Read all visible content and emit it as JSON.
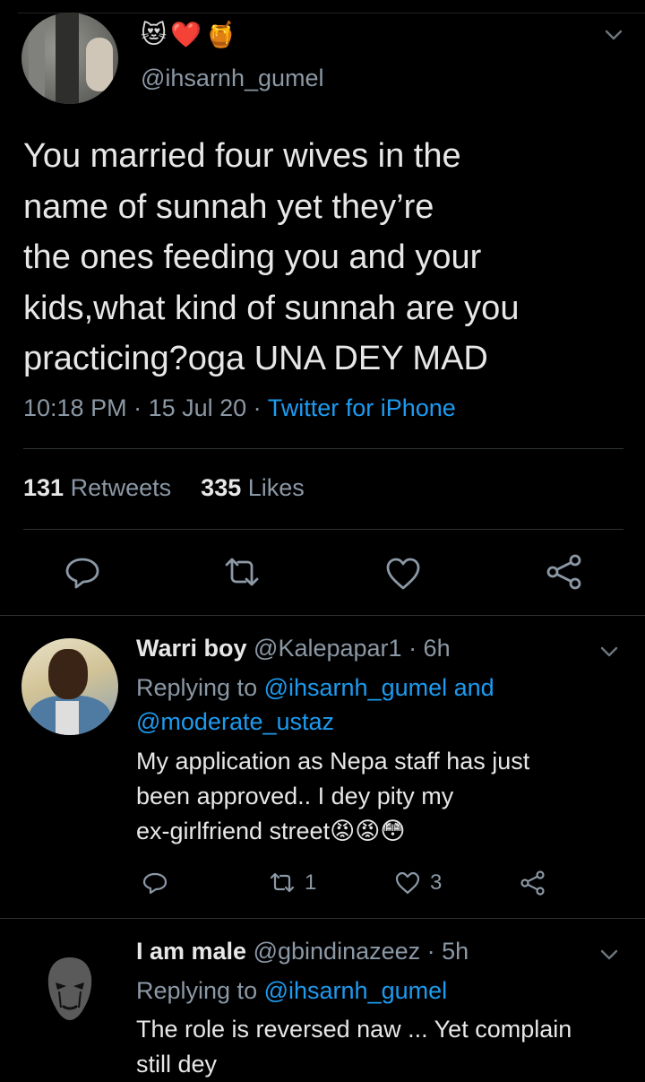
{
  "main_tweet": {
    "emojis": [
      "😻",
      "❤️",
      "🍯"
    ],
    "handle": "@ihsarnh_gumel",
    "text_lines": [
      "You married four wives in the",
      "name of sunnah yet they’re",
      "the ones feeding you and your",
      "kids,what kind of sunnah are you",
      "practicing?oga UNA DEY MAD"
    ],
    "time": "10:18 PM",
    "sep": " · ",
    "date": "15 Jul 20",
    "source": "Twitter for iPhone",
    "retweet_count": "131",
    "retweet_label": "Retweets",
    "like_count": "335",
    "like_label": "Likes"
  },
  "replies": [
    {
      "name": "Warri boy",
      "handle": "@Kalepapar1 · 6h",
      "replying_prefix": "Replying to",
      "mention1": "@ihsarnh_gumel and",
      "mention2": "@moderate_ustaz",
      "text_lines": [
        "My application as Nepa staff has just",
        "been approved.. I dey pity my",
        "ex-girlfriend street"
      ],
      "text_emojis": "😡😡😳",
      "retweets": "1",
      "likes": "3"
    },
    {
      "name": "I am male",
      "handle": "@gbindinazeez · 5h",
      "replying_prefix": "Replying to",
      "mention1": "@ihsarnh_gumel",
      "text_lines": [
        "The role is reversed naw ... Yet complain",
        "still dey"
      ]
    }
  ],
  "colors": {
    "background": "#000000",
    "accent": "#1d9bf0",
    "secondary_text": "#8b98a5",
    "primary_text": "#e7e7e7",
    "divider": "#2f3336"
  },
  "icons": {
    "reply": "speech-bubble-icon",
    "retweet": "retweet-arrows-icon",
    "like": "heart-icon",
    "share": "share-nodes-icon",
    "more": "chevron-down-icon"
  }
}
